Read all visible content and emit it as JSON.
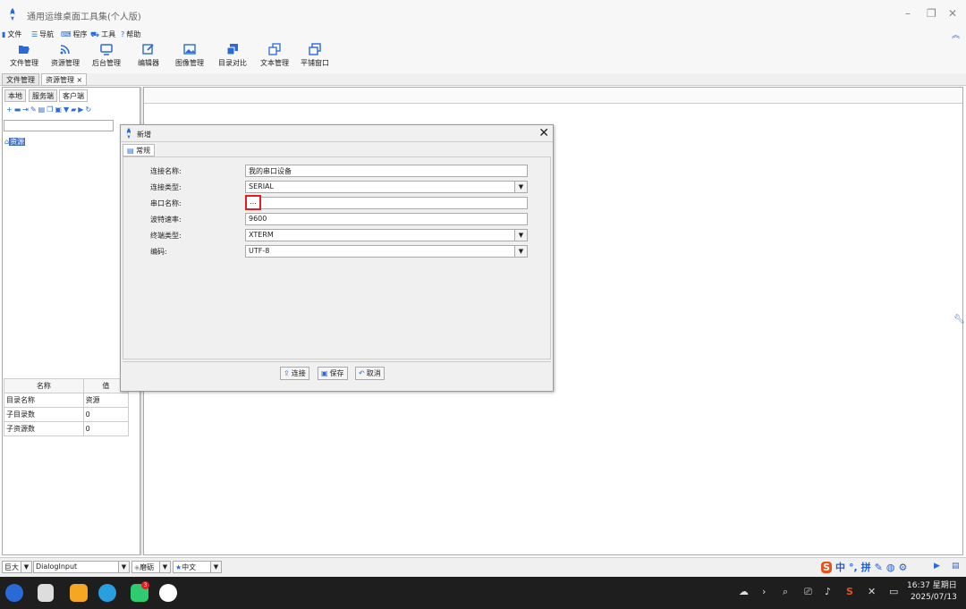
{
  "window": {
    "title": "通用运维桌面工具集(个人版)"
  },
  "menu": [
    {
      "label": "文件",
      "icon": "file-icon"
    },
    {
      "label": "导航",
      "icon": "menu-icon"
    },
    {
      "label": "程序",
      "icon": "keyboard-icon"
    },
    {
      "label": "工具",
      "icon": "car-icon"
    },
    {
      "label": "帮助",
      "icon": "help-icon"
    }
  ],
  "toolbar": [
    {
      "label": "文件管理",
      "icon": "folder-open-icon"
    },
    {
      "label": "资源管理",
      "icon": "wifi-icon"
    },
    {
      "label": "后台管理",
      "icon": "monitor-icon"
    },
    {
      "label": "编辑器",
      "icon": "edit-icon"
    },
    {
      "label": "图像管理",
      "icon": "image-icon"
    },
    {
      "label": "目录对比",
      "icon": "copy-icon"
    },
    {
      "label": "文本管理",
      "icon": "document-icon"
    },
    {
      "label": "平铺窗口",
      "icon": "windows-icon"
    }
  ],
  "doc_tabs": [
    "文件管理",
    "资源管理 ×"
  ],
  "left_tabs": [
    "本地",
    "服务端",
    "客户端"
  ],
  "tree": {
    "root": "资源"
  },
  "props": {
    "headers": [
      "名称",
      "值"
    ],
    "rows": [
      [
        "目录名称",
        "资源"
      ],
      [
        "子目录数",
        "0"
      ],
      [
        "子资源数",
        "0"
      ]
    ]
  },
  "dialog": {
    "title": "新增",
    "tab": "常规",
    "fields": [
      {
        "label": "连接名称:",
        "value": "我的串口设备",
        "type": "text"
      },
      {
        "label": "连接类型:",
        "value": "SERIAL",
        "type": "select"
      },
      {
        "label": "串口名称:",
        "value": "",
        "type": "browse"
      },
      {
        "label": "波特速率:",
        "value": "9600",
        "type": "text"
      },
      {
        "label": "终端类型:",
        "value": "XTERM",
        "type": "select"
      },
      {
        "label": "编码:",
        "value": "UTF-8",
        "type": "select"
      }
    ],
    "browse_label": "...",
    "buttons": [
      "连接",
      "保存",
      "取消"
    ]
  },
  "status": {
    "font_size": "巨大",
    "font_name": "DialogInput",
    "theme": "磨砺",
    "language": "中文"
  },
  "ime": {
    "lang": "中",
    "mode": "拼"
  },
  "clock": {
    "time": "16:37 星期日",
    "date": "2025/07/13"
  },
  "taskbar_badge": "3",
  "colors": {
    "accent": "#2a6ad8",
    "highlight": "#e02020",
    "taskbar": "#1e1e1e"
  }
}
